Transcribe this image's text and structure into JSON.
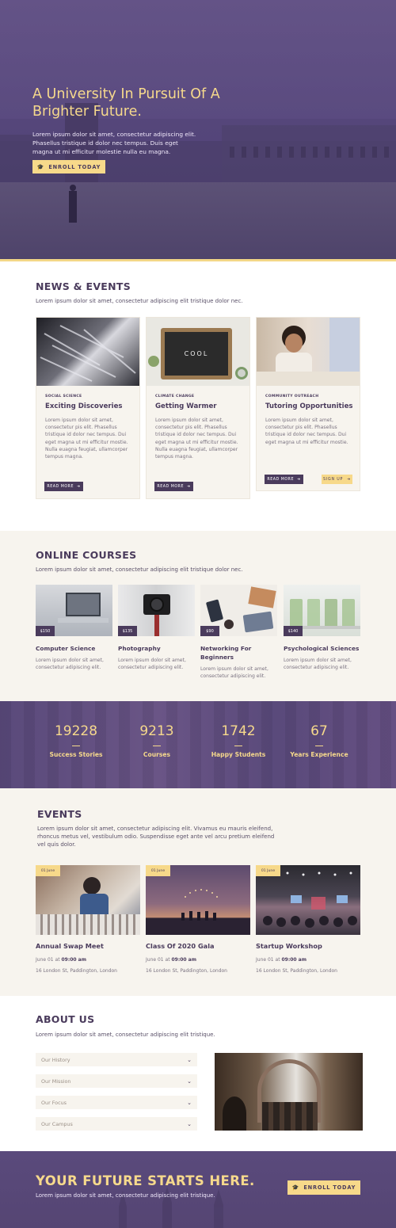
{
  "hero": {
    "title": "A University In Pursuit Of A Brighter Future.",
    "text": "Lorem ipsum dolor sit amet, consectetur adipiscing elit. Phasellus tristique id dolor nec tempus. Duis eget magna ut mi efficitur molestie nulla eu magna.",
    "button": "ENROLL TODAY",
    "button_icon": "graduation-cap-icon"
  },
  "news": {
    "title": "NEWS & EVENTS",
    "lead": "Lorem ipsum dolor sit amet, consectetur adipiscing elit tristique dolor nec.",
    "cards": [
      {
        "tag": "SOCIAL SCIENCE",
        "title": "Exciting Discoveries",
        "text": "Lorem ipsum dolor sit amet, consectetur pis elit. Phasellus tristique id dolor nec tempus. Dui eget magna ut mi efficitur mostie. Nulla euagna feugiat, ullamcorper tempus magna.",
        "button": "READ MORE"
      },
      {
        "tag": "CLIMATE CHANGE",
        "title": "Getting Warmer",
        "text": "Lorem ipsum dolor sit amet, consectetur pis elit. Phasellus tristique id dolor nec tempus. Dui eget magna ut mi efficitur mostie. Nulla euagna feugiat, ullamcorper tempus magna.",
        "button": "READ MORE",
        "image_text": "COOL"
      },
      {
        "tag": "COMMUNITY OUTREACH",
        "title": "Tutoring Opportunities",
        "text": "Lorem ipsum dolor sit amet, consectetur pis elit. Phasellus tristique id dolor nec tempus. Dui eget magna ut mi efficitur mostie.",
        "button": "READ MORE",
        "button2": "SIGN UP"
      }
    ]
  },
  "courses": {
    "title": "ONLINE COURSES",
    "lead": "Lorem ipsum dolor sit amet, consectetur adipiscing elit tristique dolor nec.",
    "items": [
      {
        "price": "$150",
        "title": "Computer Science",
        "text": "Lorem ipsum dolor sit amet, consectetur adipiscing elit."
      },
      {
        "price": "$135",
        "title": "Photography",
        "text": "Lorem ipsum dolor sit amet, consectetur adipiscing elit."
      },
      {
        "price": "$90",
        "title": "Networking For Beginners",
        "text": "Lorem ipsum dolor sit amet, consectetur adipiscing elit."
      },
      {
        "price": "$140",
        "title": "Psychological Sciences",
        "text": "Lorem ipsum dolor sit amet, consectetur adipiscing elit."
      }
    ]
  },
  "stats": [
    {
      "number": "19228",
      "label": "Success Stories"
    },
    {
      "number": "9213",
      "label": "Courses"
    },
    {
      "number": "1742",
      "label": "Happy Students"
    },
    {
      "number": "67",
      "label": "Years Experience"
    }
  ],
  "events": {
    "title": "EVENTS",
    "lead": "Lorem ipsum dolor sit amet, consectetur adipiscing elit. Vivamus eu mauris eleifend, rhoncus metus vel, vestibulum odio. Suspendisse eget ante vel arcu pretium eleifend vel quis dolor.",
    "items": [
      {
        "date": "01 June",
        "title": "Annual Swap Meet",
        "time_prefix": "June 01 at",
        "time": "09:00 am",
        "place": "16 London St, Paddington, London"
      },
      {
        "date": "01 June",
        "title": "Class Of 2020 Gala",
        "time_prefix": "June 01 at",
        "time": "09:00 am",
        "place": "16 London St, Paddington, London"
      },
      {
        "date": "01 June",
        "title": "Startup Workshop",
        "time_prefix": "June 01 at",
        "time": "09:00 am",
        "place": "16 London St, Paddington, London"
      }
    ]
  },
  "about": {
    "title": "ABOUT US",
    "lead": "Lorem ipsum dolor sit amet, consectetur adipiscing elit tristique.",
    "accordion": [
      "Our History",
      "Our Mission",
      "Our Focus",
      "Our Campus"
    ]
  },
  "cta": {
    "title": "YOUR FUTURE STARTS HERE.",
    "text": "Lorem ipsum dolor sit amet, consectetur adipiscing elit tristique.",
    "button": "ENROLL TODAY"
  },
  "colors": {
    "primary": "#4a3b5c",
    "accent": "#f7d98a",
    "cream": "#f7f4ee"
  }
}
